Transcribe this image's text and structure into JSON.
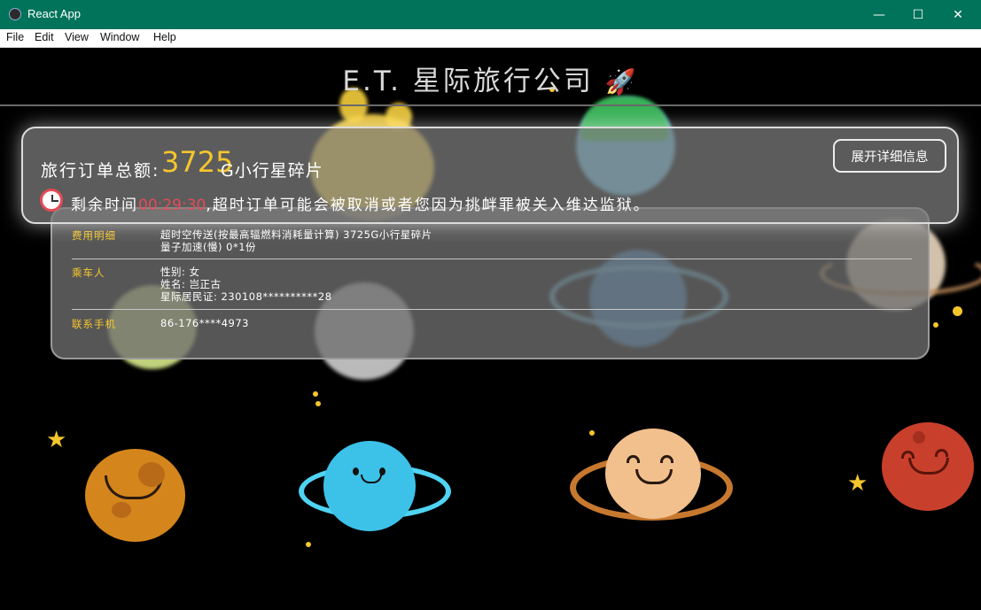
{
  "window": {
    "title": "React App",
    "controls": [
      "—",
      "☐",
      "✕"
    ]
  },
  "menu": {
    "items": [
      "File",
      "Edit",
      "View",
      "Window",
      "Help"
    ]
  },
  "page": {
    "title": "E.T. 星际旅行公司",
    "rocket_icon": "🚀"
  },
  "summary": {
    "total_label": "旅行订单总额:",
    "total_amount": "3725",
    "total_unit": "G小行星碎片",
    "expand_button": "展开详细信息",
    "timer_prefix": "剩余时间",
    "timer_value": "00:29:30",
    "timer_suffix": ",超时订单可能会被取消或者您因为挑衅罪被关入维达监狱。"
  },
  "details": {
    "fees_label": "费用明细",
    "fees_line1": "超时空传送(按最高辐燃料消耗量计算) 3725G小行星碎片",
    "fees_line2": "量子加速(慢) 0*1份",
    "passenger_label": "乘车人",
    "passenger_gender": "性别: 女",
    "passenger_name": "姓名: 岂正古",
    "passenger_id": "星际居民证: 230108**********28",
    "phone_label": "联系手机",
    "phone_value": "86-176****4973"
  },
  "colors": {
    "titlebar": "#00735a",
    "accent_yellow": "#f5c62c",
    "timer_red": "#e54b56"
  }
}
